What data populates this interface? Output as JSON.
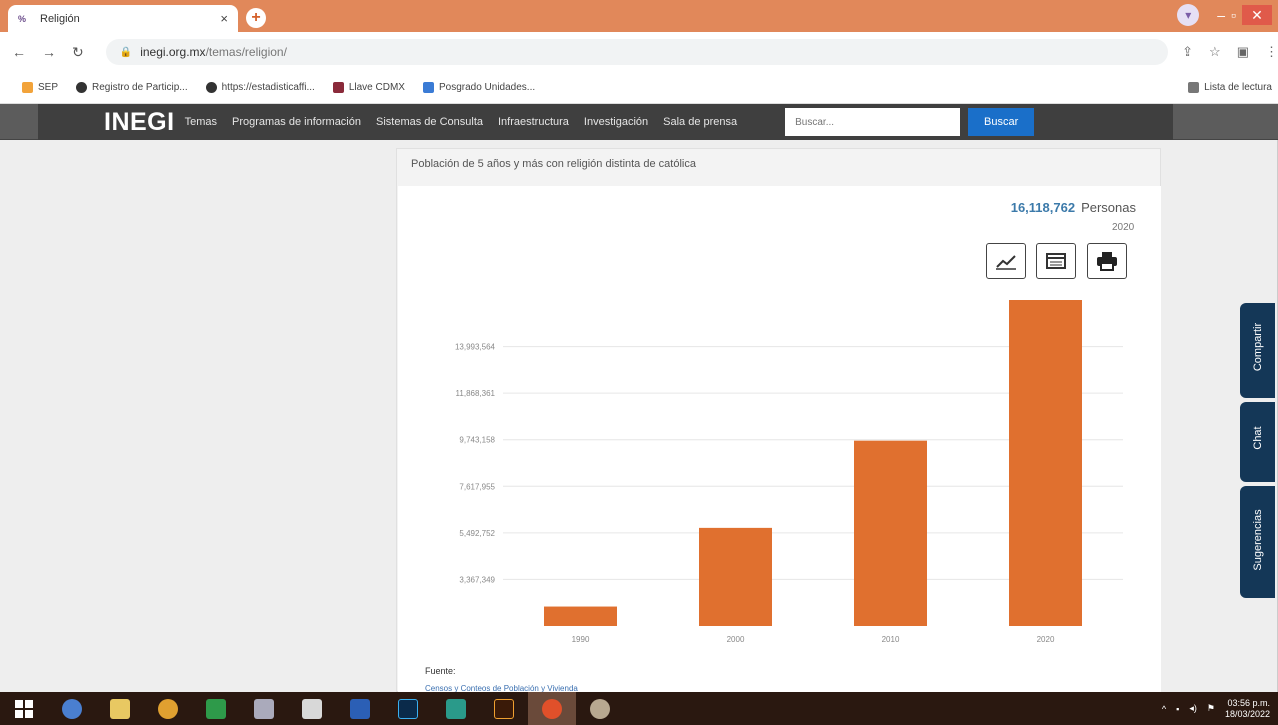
{
  "browser": {
    "tab_title": "Religión",
    "tab_close": "×",
    "new_tab": "+",
    "url_domain": "inegi.org.mx",
    "url_path": "/temas/religion/",
    "bookmarks": [
      {
        "label": "SEP",
        "color": "#f2a33a"
      },
      {
        "label": "Registro de Particip...",
        "color": "#333333"
      },
      {
        "label": "https://estadisticaffi...",
        "color": "#333333"
      },
      {
        "label": "Llave CDMX",
        "color": "#8a2a3a"
      },
      {
        "label": "Posgrado Unidades...",
        "color": "#3a7bd5"
      }
    ],
    "reading_list": "Lista de lectura"
  },
  "site_nav": {
    "logo": "INEGI",
    "links": [
      "Temas",
      "Programas de información",
      "Sistemas de Consulta",
      "Infraestructura",
      "Investigación",
      "Sala de prensa"
    ],
    "search_placeholder": "Buscar...",
    "search_button": "Buscar"
  },
  "panel": {
    "title": "Población de 5 años y más con religión distinta de católica",
    "total_value": "16,118,762",
    "total_unit": "Personas",
    "total_year": "2020",
    "fuente_label": "Fuente:",
    "fuente_link": "Censos y Conteos de Población y Vivienda"
  },
  "chart_data": {
    "type": "bar",
    "categories": [
      "1990",
      "2000",
      "2010",
      "2020"
    ],
    "values": [
      2130000,
      5720000,
      9700000,
      16118762
    ],
    "y_ticks": [
      3367349,
      5492752,
      7617955,
      9743158,
      11868361,
      13993564
    ],
    "y_tick_labels": [
      "3,367,349",
      "5,492,752",
      "7,617,955",
      "9,743,158",
      "11,868,361",
      "13,993,564"
    ],
    "ylim": [
      1242146,
      16118762
    ],
    "bar_color": "#e0702f"
  },
  "side_tabs": [
    "Compartir",
    "Chat",
    "Sugerencias"
  ],
  "taskbar": {
    "time": "03:56 p.m.",
    "date": "18/03/2022"
  }
}
